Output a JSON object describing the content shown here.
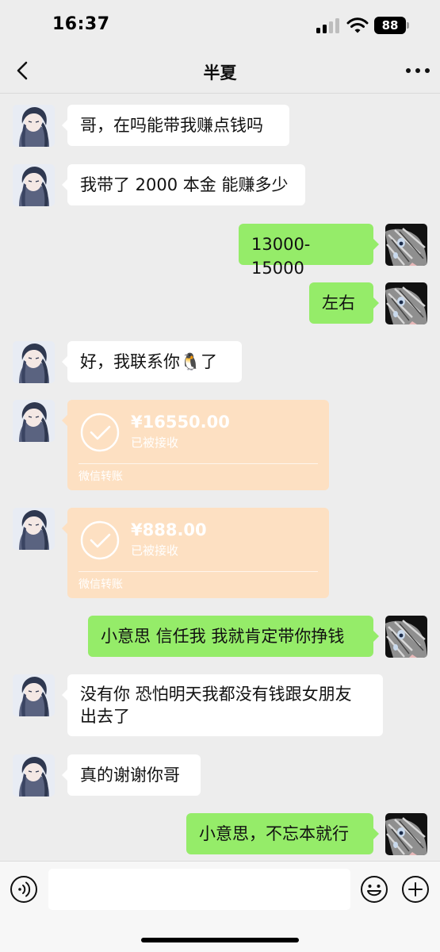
{
  "status_bar": {
    "time": "16:37",
    "battery": "88"
  },
  "header": {
    "title": "半夏",
    "back_icon": "chevron-left-icon",
    "more_icon": "ellipsis-icon"
  },
  "messages": [
    {
      "side": "in",
      "type": "text",
      "text": "哥，在吗能带我赚点钱吗"
    },
    {
      "side": "in",
      "type": "text",
      "text": "我带了 2000 本金 能赚多少"
    },
    {
      "side": "out",
      "type": "text",
      "text": "13000-15000"
    },
    {
      "side": "out",
      "type": "text",
      "text": "左右"
    },
    {
      "side": "in",
      "type": "text",
      "text": "好，我联系你",
      "emoji": "🐧",
      "text_after": "了"
    },
    {
      "side": "in",
      "type": "transfer",
      "amount": "¥16550.00",
      "status": "已被接收",
      "label": "微信转账"
    },
    {
      "side": "in",
      "type": "transfer",
      "amount": "¥888.00",
      "status": "已被接收",
      "label": "微信转账"
    },
    {
      "side": "out",
      "type": "text",
      "text": "小意思 信任我 我就肯定带你挣钱"
    },
    {
      "side": "in",
      "type": "text",
      "text_line1": "没有你 恐怕明天我都没有钱跟女朋友",
      "text_line2": "出去了"
    },
    {
      "side": "in",
      "type": "text",
      "text": "真的谢谢你哥"
    },
    {
      "side": "out",
      "type": "text",
      "text": "小意思，不忘本就行"
    }
  ],
  "input_bar": {
    "value": "",
    "voice_icon": "voice-icon",
    "emoji_icon": "smiley-icon",
    "plus_icon": "plus-icon"
  },
  "colors": {
    "background": "#ededed",
    "bubble_in": "#ffffff",
    "bubble_out": "#95ec69",
    "transfer": "#fde0c2"
  }
}
